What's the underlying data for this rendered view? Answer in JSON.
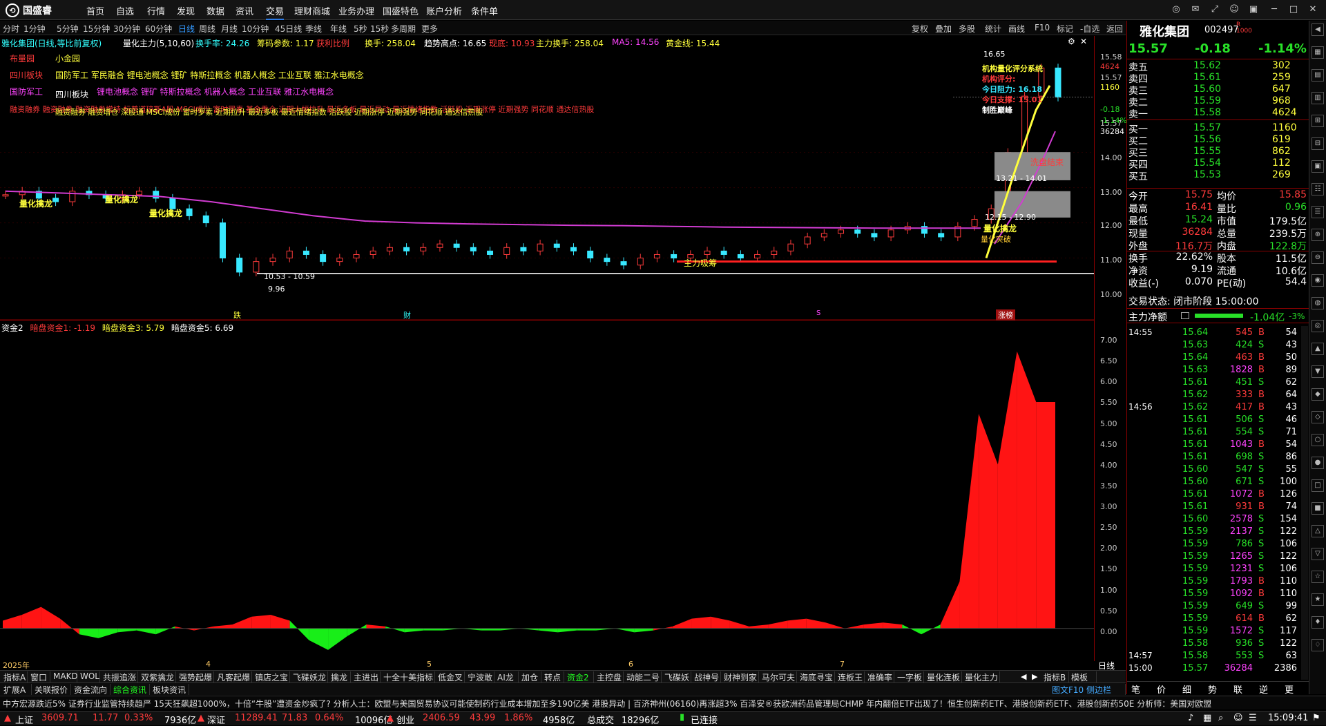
{
  "menubar": {
    "brand": "国盛睿",
    "items": [
      "首页",
      "自选",
      "行情",
      "发现",
      "数据",
      "资讯",
      "交易",
      "理财商城",
      "业务办理",
      "国盛特色",
      "账户分析",
      "条件单"
    ],
    "active": "交易"
  },
  "periodbar": {
    "periods": [
      "分时",
      "1分钟",
      "5分钟",
      "15分钟",
      "30分钟",
      "60分钟",
      "日线",
      "周线",
      "月线",
      "10分钟",
      "45日线",
      "季线",
      "年线",
      "5秒",
      "15秒",
      "多周期",
      "更多"
    ],
    "active": "日线",
    "tools": [
      "复权",
      "叠加",
      "多股",
      "统计",
      "画线",
      "F10",
      "标记",
      "-自选",
      "返回"
    ]
  },
  "indicator_line": {
    "stock_name": "雅化集团(日线,等比前复权)",
    "series_name": "量化主力(5,10,60)",
    "turnover_rate": "换手率: 24.26",
    "chip_param": "筹码参数: 1.17",
    "profit_ratio": "获利比例",
    "turnover": "换手: 258.04",
    "trend_high": "趋势高点: 16.65",
    "current_price": "现底: 10.93",
    "main_turnover": "主力换手: 258.04",
    "ma5": "MA5: 14.56",
    "golden_line": "黄金线: 15.44"
  },
  "tags": {
    "line1_a": "布量园",
    "line1_b": "小金园",
    "line2_label": "四川板块",
    "line2_text": "国防军工 军民融合 锂电池概念 锂矿 特斯拉概念 机器人概念 工业互联 雅江水电概念",
    "line3_a": "国防军工",
    "line3_b": "四川板块",
    "line3_text": "锂电池概念 锂矿 特斯拉概念 机器人概念 工业互联 雅江水电概念",
    "line4": "融资融券 融资融券 融资融券增持 标普道琼斯A股 MSCI成份 富时罗素 基金重仓 近期大幅拉升 最近多板 最近异动 最近情绪指数 活跃股 近期涨停 近期强势 同花顺 通达信热股",
    "line5": "融资融券 融资增仓 深股通 MSCI成份 富时罗素 近期拉升 最近多板 最近情绪指数 活跃股 近期涨停 近期强势 同花顺 通达信热股"
  },
  "chart_labels": {
    "signal": "量化擒龙",
    "range_low": "10.53 - 10.59",
    "low_point": "9.96",
    "high_point": "16.65",
    "box_upper_label": "洗盘结束",
    "box_range": "13.21 - 14.01",
    "box_lower_range": "12.15 - 12.90",
    "main_absorb": "主力吸筹",
    "signal_dragon": "量化擒龙",
    "buy_signal": "量化突破",
    "overlay_lines": [
      "机构量化评分系统",
      "机构评分:",
      "今日阻力: 16.18",
      "今日支撑: 15.01",
      "制胜巅峰"
    ],
    "marker_die": "跌",
    "marker_cai": "财",
    "marker_s": "S",
    "marker_zt": "涨榜"
  },
  "chart_data": {
    "type": "line",
    "title": "雅化集团(日线,等比前复权)",
    "ylim": [
      9.5,
      16.8
    ],
    "yticks": [
      "15.58",
      "15.57",
      "15.57",
      "14.00",
      "13.00",
      "12.00",
      "11.00",
      "10.00"
    ],
    "right_labels": [
      "4624",
      "1160",
      "-0.18",
      "-1.14%",
      "36284"
    ],
    "x_ticks": [
      "2025年",
      "4",
      "5",
      "6",
      "7"
    ],
    "candles_summary": [
      12.8,
      12.9,
      12.7,
      12.6,
      12.9,
      12.8,
      12.7,
      12.8,
      12.9,
      12.7,
      12.4,
      12.2,
      12.0,
      11.0,
      10.6,
      10.9,
      11.0,
      11.2,
      11.1,
      10.9,
      11.0,
      11.1,
      11.2,
      11.3,
      11.2,
      11.3,
      11.4,
      11.3,
      11.2,
      11.1,
      11.3,
      11.2,
      11.4,
      11.3,
      11.2,
      11.0,
      10.9,
      10.8,
      11.0,
      11.1,
      11.0,
      11.1,
      11.2,
      11.1,
      11.0,
      11.1,
      11.2,
      11.4,
      11.6,
      11.7,
      11.8,
      11.7,
      11.6,
      11.8,
      11.9,
      11.7,
      11.6,
      11.9,
      12.1,
      12.4,
      14.0,
      15.6,
      16.4,
      15.57
    ],
    "ma60": [
      12.9,
      12.85,
      12.8,
      12.75,
      12.6,
      12.4,
      12.2,
      12.05,
      12.0,
      11.97,
      11.95,
      11.93,
      11.92,
      11.9,
      11.88,
      11.87,
      11.86,
      11.85,
      11.85,
      11.85
    ],
    "sub_chart": {
      "title": "资金2",
      "items": [
        "暗盘资金1: -1.19",
        "暗盘资金3: 5.79",
        "暗盘资金5: 6.69"
      ],
      "ylim": [
        -0.5,
        7.5
      ],
      "yticks": [
        "7.00",
        "6.50",
        "6.00",
        "5.50",
        "5.00",
        "4.50",
        "4.00",
        "3.50",
        "3.00",
        "2.50",
        "2.00",
        "1.50",
        "1.00",
        "0.50",
        "0.00"
      ],
      "values": [
        0.2,
        0.35,
        0.55,
        0.25,
        -0.15,
        -0.25,
        -0.1,
        -0.05,
        -0.15,
        0.05,
        -0.05,
        0.05,
        0.1,
        0.3,
        0.35,
        0.2,
        -0.3,
        -0.55,
        -0.2,
        0.1,
        0.05,
        -0.1,
        -0.05,
        -0.05,
        0.0,
        -0.05,
        -0.05,
        0.0,
        -0.05,
        -0.1,
        -0.05,
        -0.05,
        0.0,
        -0.1,
        -0.05,
        0.05,
        0.25,
        0.3,
        0.2,
        0.05,
        0.1,
        0.2,
        0.25,
        0.15,
        0.0,
        0.1,
        0.15,
        0.1,
        -0.15,
        0.1,
        1.2,
        5.5,
        4.2,
        7.1,
        5.8,
        5.8
      ]
    }
  },
  "quote": {
    "name": "雅化集团",
    "code": "002497",
    "price": "15.57",
    "change": "-0.18",
    "change_pct": "-1.14%",
    "asks": [
      [
        "卖五",
        "15.62",
        "302"
      ],
      [
        "卖四",
        "15.61",
        "259"
      ],
      [
        "卖三",
        "15.60",
        "647"
      ],
      [
        "卖二",
        "15.59",
        "968"
      ],
      [
        "卖一",
        "15.58",
        "4624"
      ]
    ],
    "bids": [
      [
        "买一",
        "15.57",
        "1160"
      ],
      [
        "买二",
        "15.56",
        "619"
      ],
      [
        "买三",
        "15.55",
        "862"
      ],
      [
        "买四",
        "15.54",
        "112"
      ],
      [
        "买五",
        "15.53",
        "269"
      ]
    ],
    "stats": [
      [
        "今开",
        "15.75",
        "均价",
        "15.85"
      ],
      [
        "最高",
        "16.41",
        "量比",
        "0.96"
      ],
      [
        "最低",
        "15.24",
        "市值",
        "179.5亿"
      ],
      [
        "现量",
        "36284",
        "总量",
        "239.5万"
      ],
      [
        "外盘",
        "116.7万",
        "内盘",
        "122.8万"
      ],
      [
        "换手",
        "22.62%",
        "股本",
        "11.5亿"
      ],
      [
        "净资",
        "9.19",
        "流通",
        "10.6亿"
      ],
      [
        "收益(-)",
        "0.070",
        "PE(动)",
        "54.4"
      ]
    ],
    "trade_status": "交易状态: 闭市阶段 15:00:00",
    "net_label": "主力净额",
    "net_value": "-1.04亿",
    "net_pct": "-3%"
  },
  "ticks": [
    [
      "14:55",
      "15.64",
      "545",
      "B",
      "54"
    ],
    [
      "",
      "15.63",
      "424",
      "S",
      "43"
    ],
    [
      "",
      "15.64",
      "463",
      "B",
      "50"
    ],
    [
      "",
      "15.63",
      "1828",
      "B",
      "89"
    ],
    [
      "",
      "15.61",
      "451",
      "S",
      "62"
    ],
    [
      "",
      "15.62",
      "333",
      "B",
      "64"
    ],
    [
      "14:56",
      "15.62",
      "417",
      "B",
      "43"
    ],
    [
      "",
      "15.61",
      "506",
      "S",
      "46"
    ],
    [
      "",
      "15.61",
      "554",
      "S",
      "71"
    ],
    [
      "",
      "15.61",
      "1043",
      "B",
      "54"
    ],
    [
      "",
      "15.61",
      "698",
      "S",
      "86"
    ],
    [
      "",
      "15.60",
      "547",
      "S",
      "55"
    ],
    [
      "",
      "15.60",
      "671",
      "S",
      "100"
    ],
    [
      "",
      "15.61",
      "1072",
      "B",
      "126"
    ],
    [
      "",
      "15.61",
      "931",
      "B",
      "74"
    ],
    [
      "",
      "15.60",
      "2578",
      "S",
      "154"
    ],
    [
      "",
      "15.59",
      "2137",
      "S",
      "122"
    ],
    [
      "",
      "15.59",
      "786",
      "S",
      "106"
    ],
    [
      "",
      "15.59",
      "1265",
      "S",
      "122"
    ],
    [
      "",
      "15.59",
      "1231",
      "S",
      "106"
    ],
    [
      "",
      "15.59",
      "1793",
      "B",
      "110"
    ],
    [
      "",
      "15.59",
      "1092",
      "B",
      "110"
    ],
    [
      "",
      "15.59",
      "649",
      "S",
      "99"
    ],
    [
      "",
      "15.59",
      "614",
      "B",
      "62"
    ],
    [
      "",
      "15.59",
      "1572",
      "S",
      "117"
    ],
    [
      "",
      "15.58",
      "936",
      "S",
      "122"
    ],
    [
      "14:57",
      "15.58",
      "553",
      "S",
      "63"
    ],
    [
      "15:00",
      "15.57",
      "36284",
      "",
      "2386"
    ]
  ],
  "rightpanel_tabs": [
    "笔",
    "价",
    "细",
    "势",
    "联",
    "逆",
    "更"
  ],
  "tabs1": [
    "指标A",
    "窗口",
    "MAKD",
    "WOL",
    "共振追涨",
    "双紫擒龙",
    "强势起爆",
    "凡客起爆",
    "镇店之宝",
    "飞碟妖龙",
    "擒龙",
    "主进出",
    "十全十美指标",
    "低金叉",
    "宁波敢",
    "AI龙",
    "加仓",
    "转点",
    "资金2",
    "主控盘",
    "动能二号",
    "飞碟妖",
    "战神号",
    "财神到家",
    "马尔可夫",
    "海底寻宝",
    "连板王",
    "准确率",
    "一字板",
    "量化连板",
    "量化主力"
  ],
  "tabs1_active": "资金2",
  "tabs1_right": [
    "指标B",
    "模板"
  ],
  "tabs2": [
    "扩展A",
    "关联报价",
    "资金流向",
    "综合资讯",
    "板块资讯"
  ],
  "tabs2_right": "图文F10 侧边栏",
  "period_right": "日线",
  "news": "中方宏源跌近5% 证券行业监管持续趋严    15天狂飙超1000%，十倍“牛股”遭资金炒疯了?    分析人士：欧盟与美国贸易协议可能使制药行业成本增加至多190亿美    港股异动 | 百济神州(06160)再涨超3% 百泽安®获欧洲药品管理局CHMP    年内翻倍ETF出现了！恒生创新药ETF、港股创新药ETF、港股创新药50E    分析师：美国对欧盟",
  "status": {
    "sh_label": "上证",
    "sh_val": "3609.71",
    "sh_chg": "11.77",
    "sh_pct": "0.33%",
    "sh_amt": "7936亿",
    "sz_label": "深证",
    "sz_val": "11289.41",
    "sz_chg": "71.83",
    "sz_pct": "0.64%",
    "sz_amt": "10096亿",
    "cy_label": "创业",
    "cy_val": "2406.59",
    "cy_chg": "43.99",
    "cy_pct": "1.86%",
    "cy_amt": "4958亿",
    "total_label": "总成交",
    "total_amt": "18296亿",
    "conn": "已连接",
    "time": "15:09:41"
  },
  "colors": {
    "up": "#ff3b3b",
    "down": "#28e028",
    "ma": "#d23cd2",
    "accent": "#2d7be5"
  }
}
